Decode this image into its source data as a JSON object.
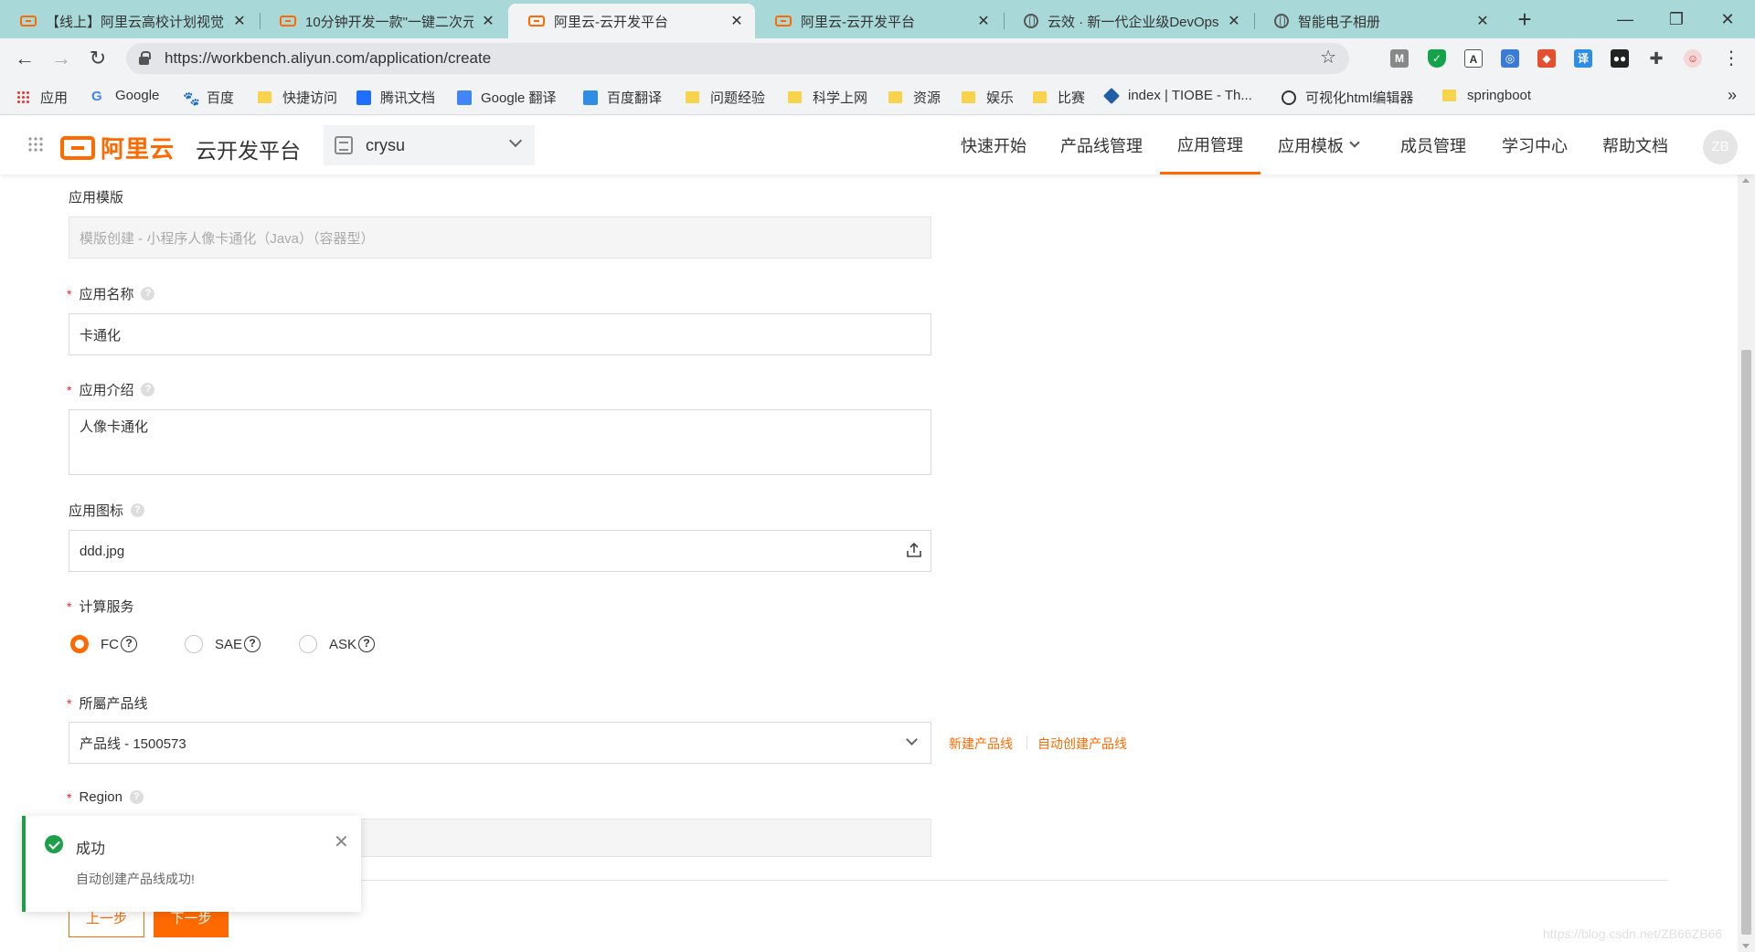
{
  "tabs": [
    {
      "title": "【线上】阿里云高校计划视觉"
    },
    {
      "title": "10分钟开发一款\"一键二次元"
    },
    {
      "title": "阿里云-云开发平台"
    },
    {
      "title": "阿里云-云开发平台"
    },
    {
      "title": "云效 · 新一代企业级DevOps"
    },
    {
      "title": "智能电子相册"
    }
  ],
  "address": {
    "url": "https://workbench.aliyun.com/application/create"
  },
  "bookmarks": [
    {
      "label": "应用"
    },
    {
      "label": "Google"
    },
    {
      "label": "百度"
    },
    {
      "label": "快捷访问"
    },
    {
      "label": "腾讯文档"
    },
    {
      "label": "Google 翻译"
    },
    {
      "label": "百度翻译"
    },
    {
      "label": "问题经验"
    },
    {
      "label": "科学上网"
    },
    {
      "label": "资源"
    },
    {
      "label": "娱乐"
    },
    {
      "label": "比赛"
    },
    {
      "label": "index | TIOBE - Th..."
    },
    {
      "label": "可视化html编辑器"
    },
    {
      "label": "springboot"
    }
  ],
  "header": {
    "logo_text": "阿里云",
    "platform": "云开发平台",
    "project": "crysu",
    "nav": [
      "快速开始",
      "产品线管理",
      "应用管理",
      "应用模板",
      "成员管理",
      "学习中心",
      "帮助文档"
    ],
    "avatar": "ZB"
  },
  "form": {
    "template_label": "应用模版",
    "template_value": "模版创建 - 小程序人像卡通化（Java）（容器型）",
    "name_label": "应用名称",
    "name_value": "卡通化",
    "intro_label": "应用介绍",
    "intro_value": "人像卡通化",
    "icon_label": "应用图标",
    "icon_value": "ddd.jpg",
    "compute_label": "计算服务",
    "compute_options": [
      "FC",
      "SAE",
      "ASK"
    ],
    "compute_selected": "FC",
    "productline_label": "所屬产品线",
    "productline_value": "产品线 - 1500573",
    "new_productline": "新建产品线",
    "auto_productline": "自动创建产品线",
    "region_label": "Region",
    "help_mark": "?",
    "prev": "上一步",
    "next": "下一步"
  },
  "toast": {
    "title": "成功",
    "message": "自动创建产品线成功!"
  },
  "watermark": "https://blog.csdn.net/ZB66ZB66",
  "colors": {
    "accent": "#ff6a00",
    "success": "#1ea04a",
    "tabstrip": "#a8d8d8"
  }
}
